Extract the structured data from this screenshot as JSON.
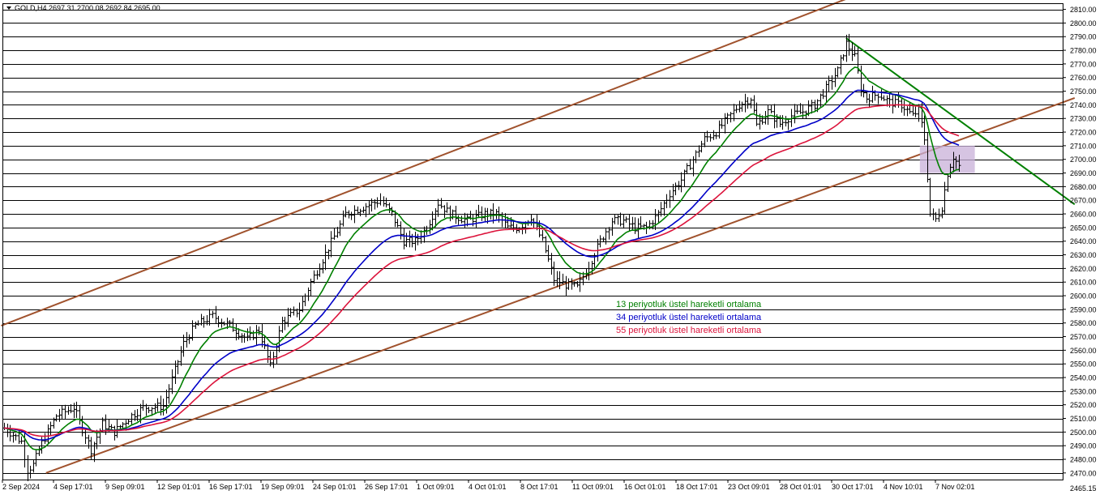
{
  "chart_data": {
    "type": "candlestick",
    "header": {
      "symbol": "GOLD,H4",
      "open": "2697.31",
      "high": "2700.08",
      "low": "2692.84",
      "close": "2695.00"
    },
    "y_range": [
      2465.15,
      2815
    ],
    "y_ticks": [
      2810,
      2800,
      2790,
      2780,
      2770,
      2760,
      2750,
      2740,
      2730,
      2720,
      2710,
      2700,
      2690,
      2680,
      2670,
      2660,
      2650,
      2640,
      2630,
      2620,
      2610,
      2600,
      2590,
      2580,
      2570,
      2560,
      2550,
      2540,
      2530,
      2520,
      2510,
      2500,
      2490,
      2480,
      2470
    ],
    "bottom_label": "2465.15",
    "x_labels": [
      "2 Sep 2024",
      "4 Sep 17:01",
      "9 Sep 09:01",
      "12 Sep 01:01",
      "16 Sep 17:01",
      "19 Sep 09:01",
      "24 Sep 01:01",
      "26 Sep 17:01",
      "1 Oct 09:01",
      "4 Oct 01:01",
      "8 Oct 17:01",
      "11 Oct 09:01",
      "16 Oct 01:01",
      "18 Oct 17:01",
      "23 Oct 09:01",
      "28 Oct 01:01",
      "30 Oct 17:01",
      "4 Nov 10:01",
      "7 Nov 02:01"
    ],
    "price_anchors": [
      [
        0,
        2503
      ],
      [
        3,
        2498
      ],
      [
        6,
        2493
      ],
      [
        8,
        2472
      ],
      [
        10,
        2476
      ],
      [
        13,
        2492
      ],
      [
        18,
        2512
      ],
      [
        24,
        2518
      ],
      [
        30,
        2487
      ],
      [
        34,
        2506
      ],
      [
        38,
        2500
      ],
      [
        44,
        2512
      ],
      [
        48,
        2518
      ],
      [
        55,
        2519
      ],
      [
        62,
        2565
      ],
      [
        66,
        2578
      ],
      [
        72,
        2585
      ],
      [
        78,
        2578
      ],
      [
        84,
        2568
      ],
      [
        88,
        2575
      ],
      [
        92,
        2548
      ],
      [
        96,
        2581
      ],
      [
        102,
        2590
      ],
      [
        106,
        2610
      ],
      [
        112,
        2635
      ],
      [
        118,
        2660
      ],
      [
        124,
        2665
      ],
      [
        130,
        2670
      ],
      [
        134,
        2660
      ],
      [
        138,
        2640
      ],
      [
        142,
        2640
      ],
      [
        146,
        2650
      ],
      [
        150,
        2668
      ],
      [
        154,
        2660
      ],
      [
        160,
        2655
      ],
      [
        166,
        2660
      ],
      [
        170,
        2660
      ],
      [
        174,
        2650
      ],
      [
        178,
        2650
      ],
      [
        182,
        2658
      ],
      [
        186,
        2640
      ],
      [
        190,
        2612
      ],
      [
        194,
        2608
      ],
      [
        198,
        2606
      ],
      [
        202,
        2622
      ],
      [
        206,
        2640
      ],
      [
        210,
        2655
      ],
      [
        214,
        2655
      ],
      [
        218,
        2650
      ],
      [
        222,
        2650
      ],
      [
        226,
        2660
      ],
      [
        230,
        2675
      ],
      [
        234,
        2685
      ],
      [
        238,
        2700
      ],
      [
        242,
        2715
      ],
      [
        246,
        2720
      ],
      [
        250,
        2730
      ],
      [
        254,
        2740
      ],
      [
        258,
        2745
      ],
      [
        260,
        2725
      ],
      [
        264,
        2735
      ],
      [
        268,
        2726
      ],
      [
        272,
        2732
      ],
      [
        276,
        2735
      ],
      [
        280,
        2740
      ],
      [
        284,
        2752
      ],
      [
        288,
        2765
      ],
      [
        291,
        2785
      ],
      [
        294,
        2775
      ],
      [
        296,
        2752
      ],
      [
        298,
        2745
      ],
      [
        302,
        2748
      ],
      [
        306,
        2742
      ],
      [
        310,
        2740
      ],
      [
        314,
        2732
      ],
      [
        316,
        2736
      ],
      [
        318,
        2715
      ],
      [
        320,
        2660
      ],
      [
        322,
        2656
      ],
      [
        324,
        2665
      ],
      [
        326,
        2690
      ],
      [
        328,
        2702
      ],
      [
        330,
        2695
      ]
    ],
    "moving_averages": [
      {
        "period": 13,
        "color": "#008000"
      },
      {
        "period": 34,
        "color": "#0000c8"
      },
      {
        "period": 55,
        "color": "#dc143c"
      }
    ],
    "legend": [
      {
        "text": "13 periyotluk üstel hareketli ortalama",
        "color": "#008000"
      },
      {
        "text": "34 periyotluk üstel hareketli ortalama",
        "color": "#0000c8"
      },
      {
        "text": "55 periyotluk üstel hareketli ortalama",
        "color": "#dc143c"
      }
    ],
    "colors": {
      "channel": "#a0522d",
      "downtrend": "#008000",
      "zone": "#c8b0d8",
      "bar": "#000000"
    }
  }
}
